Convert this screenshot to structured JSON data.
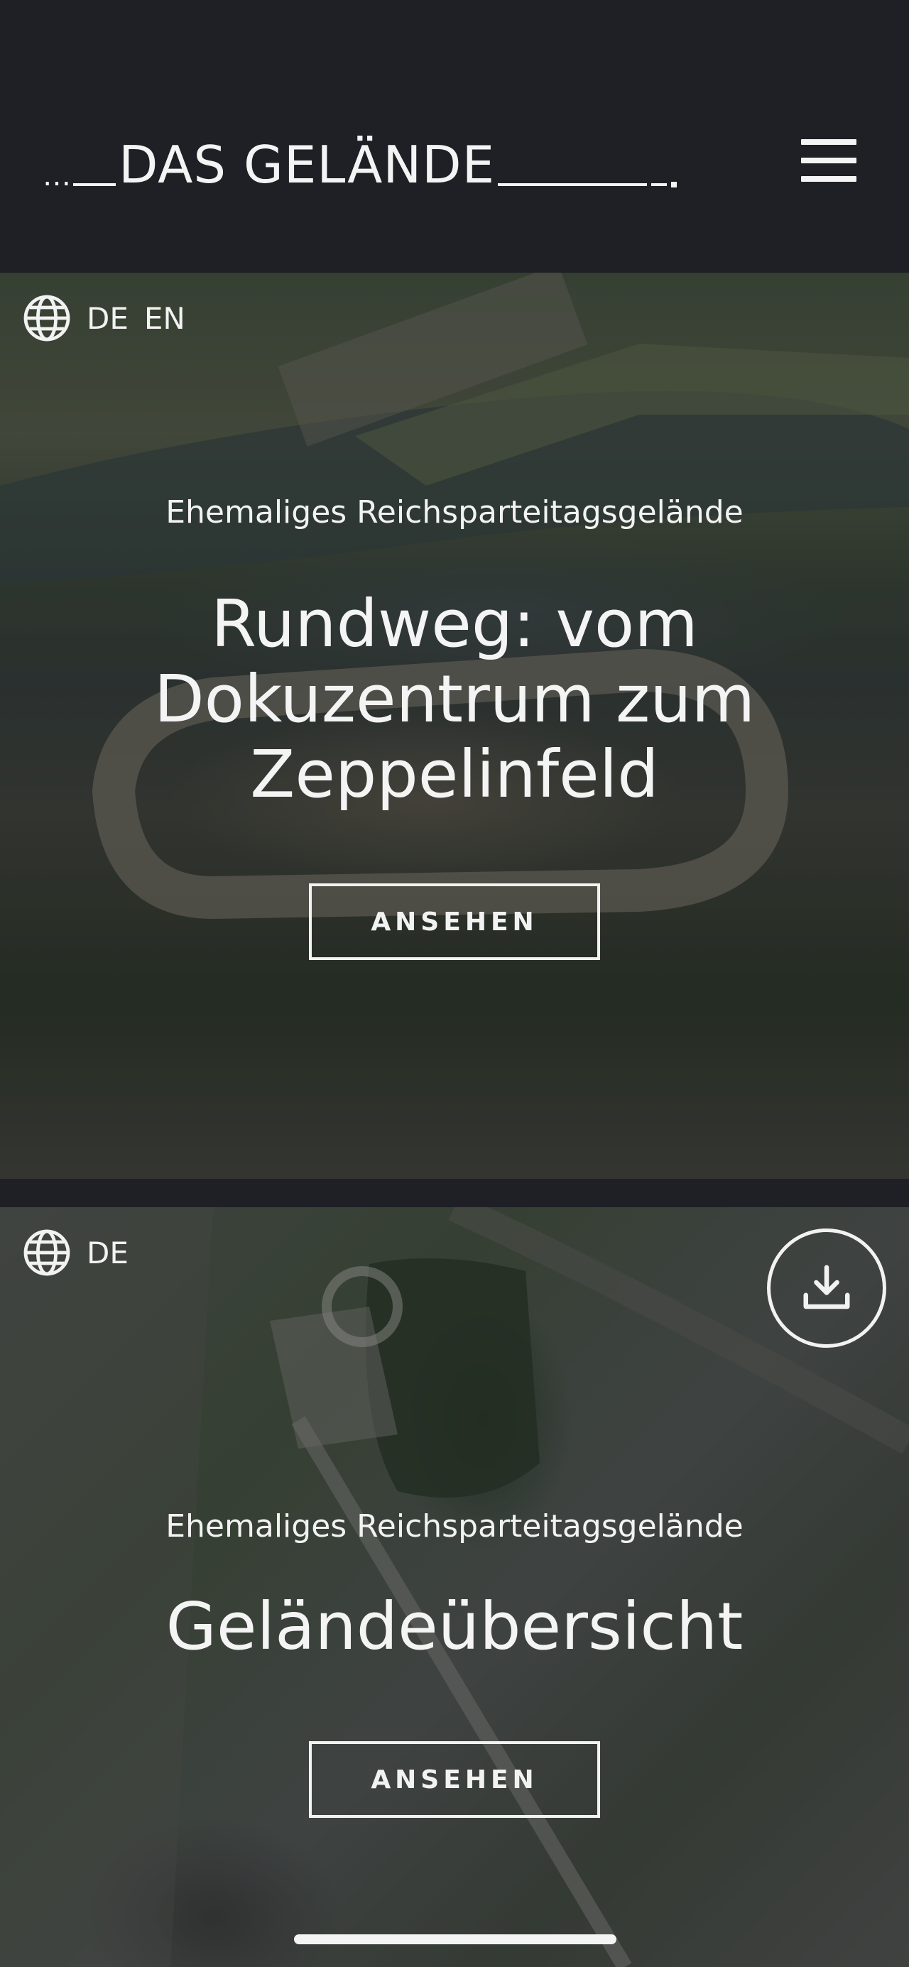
{
  "header": {
    "brand": "DAS GELÄNDE",
    "menu_icon": "hamburger-menu-icon"
  },
  "cards": [
    {
      "languages": [
        "DE",
        "EN"
      ],
      "language_icon": "globe-icon",
      "eyebrow": "Ehemaliges Reichsparteitagsgelände",
      "title": "Rundweg: vom Dokuzentrum zum Zeppelinfeld",
      "button": "ANSEHEN"
    },
    {
      "languages": [
        "DE"
      ],
      "language_icon": "globe-icon",
      "download_icon": "download-icon",
      "eyebrow": "Ehemaliges Reichsparteitagsgelände",
      "title": "Geländeübersicht",
      "button": "ANSEHEN"
    }
  ],
  "colors": {
    "background": "#1f2026",
    "text": "#f2f2f2"
  }
}
